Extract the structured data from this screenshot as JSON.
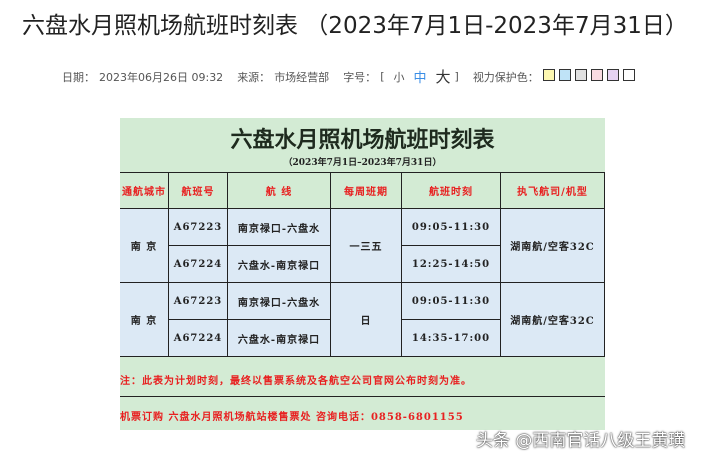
{
  "title": "六盘水月照机场航班时刻表 （2023年7月1日-2023年7月31日）",
  "meta": {
    "date_label": "日期：",
    "date": "2023年06月26日 09:32",
    "source_label": "来源：",
    "source": "市场经营部",
    "fontsize_label": "字号：",
    "lb": "[",
    "small": "小",
    "medium": "中",
    "large": "大",
    "rb": "]",
    "eye_label": "视力保护色："
  },
  "swatches": [
    "#fdf7b0",
    "#bfe3f7",
    "#e0e0e0",
    "#f9dbe2",
    "#e6d3f3",
    "#ffffff"
  ],
  "table": {
    "title": "六盘水月照机场航班时刻表",
    "subtitle": "（2023年7月1日–2023年7月31日）",
    "headers": [
      "通航城市",
      "航班号",
      "航    线",
      "每周班期",
      "航班时刻",
      "执飞航司/机型"
    ],
    "groups": [
      {
        "city": "南    京",
        "days": "一三五",
        "carrier": "湖南航/空客32C",
        "flights": [
          {
            "no": "A67223",
            "route": "南京禄口-六盘水",
            "time": "09:05-11:30"
          },
          {
            "no": "A67224",
            "route": "六盘水-南京禄口",
            "time": "12:25-14:50"
          }
        ]
      },
      {
        "city": "南    京",
        "days": "日",
        "carrier": "湖南航/空客32C",
        "flights": [
          {
            "no": "A67223",
            "route": "南京禄口-六盘水",
            "time": "09:05-11:30"
          },
          {
            "no": "A67224",
            "route": "六盘水-南京禄口",
            "time": "14:35-17:00"
          }
        ]
      }
    ],
    "note": "注：此表为计划时刻，最终以售票系统及各航空公司官网公布时刻为准。",
    "contact": "机票订购 六盘水月照机场航站楼售票处 咨询电话：0858-6801155"
  },
  "watermark": "头条 @西南官话八级王黄璜"
}
